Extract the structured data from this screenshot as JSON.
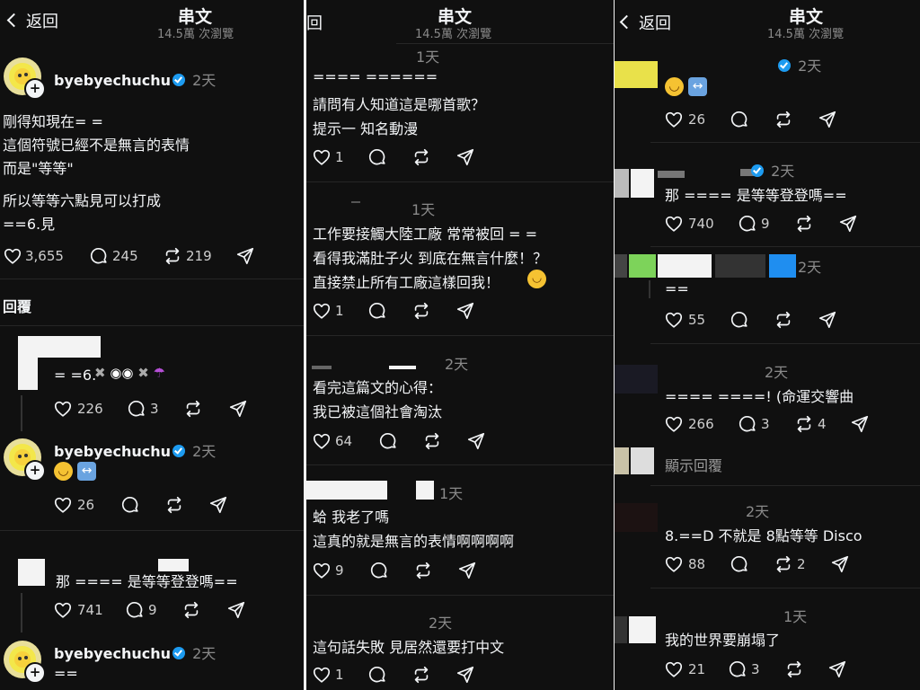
{
  "header": {
    "title": "串文",
    "views": "14.5萬 次瀏覽",
    "back": "返回",
    "back_fragment": "回"
  },
  "left": {
    "op": {
      "user": "byebyechuchu",
      "time": "2天",
      "lines": [
        "剛得知現在= =",
        "這個符號已經不是無言的表情",
        "而是\"等等\"",
        "所以等等六點見可以打成",
        "==6.見"
      ],
      "likes": "3,655",
      "comments": "245",
      "reposts": "219"
    },
    "replies_label": "回覆",
    "r1": {
      "text": "= =6.",
      "likes": "226",
      "comments": "3"
    },
    "r2": {
      "user": "byebyechuchu",
      "time": "2天",
      "likes": "26"
    },
    "r3": {
      "text": "那 ==== 是等等登登嗎==",
      "likes": "741",
      "comments": "9"
    },
    "r4": {
      "user": "byebyechuchu",
      "time": "2天",
      "text": "=="
    }
  },
  "mid": {
    "p1": {
      "time": "1天",
      "lines": [
        "==== ======",
        "請問有人知道這是哪首歌？",
        "提示一 知名動漫"
      ],
      "likes": "1"
    },
    "p2": {
      "time": "1天",
      "lines": [
        "工作要接觸大陸工廠 常常被回 = =",
        "看得我滿肚子火 到底在無言什麼！？",
        "直接禁止所有工廠這樣回我！"
      ],
      "likes": "1"
    },
    "p3": {
      "time": "2天",
      "lines": [
        "看完這篇文的心得：",
        "我已被這個社會淘汰"
      ],
      "likes": "64"
    },
    "p4": {
      "time": "1天",
      "lines": [
        "蛤 我老了嗎",
        "這真的就是無言的表情啊啊啊啊"
      ],
      "likes": "9"
    },
    "p5": {
      "time": "2天",
      "lines": [
        "這句話失敗 見居然還要打中文"
      ],
      "likes": "1"
    }
  },
  "right": {
    "c1": {
      "time": "2天",
      "likes": "26"
    },
    "c2": {
      "time": "2天",
      "text": "那 ==== 是等等登登嗎==",
      "likes": "740",
      "comments": "9"
    },
    "c3": {
      "time": "2天",
      "text": "==",
      "likes": "55"
    },
    "c4": {
      "time": "2天",
      "text": "==== ====! (命運交響曲",
      "likes": "266",
      "comments": "3",
      "reposts": "4"
    },
    "c5": {
      "text": "顯示回覆"
    },
    "c6": {
      "time": "2天",
      "text": "8.==D 不就是 8點等等 Disco",
      "likes": "88",
      "reposts": "2"
    },
    "c7": {
      "time": "1天",
      "text": "我的世界要崩塌了",
      "likes": "21",
      "comments": "3"
    }
  }
}
